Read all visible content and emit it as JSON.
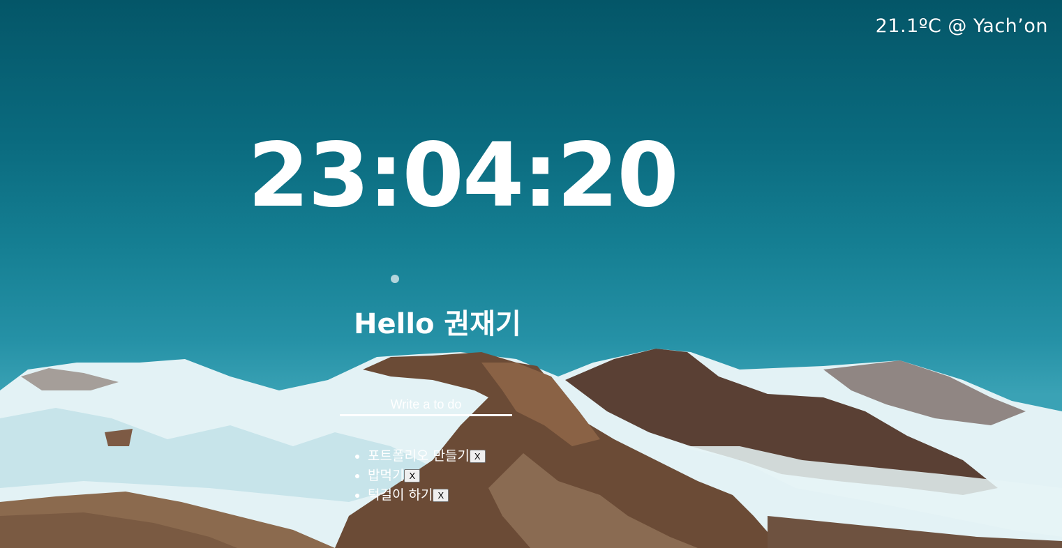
{
  "weather": {
    "text": "21.1ºC @ Yach’on"
  },
  "clock": {
    "time": "23:04:20"
  },
  "greeting": {
    "text": "Hello 권재기"
  },
  "todo_form": {
    "placeholder": "Write a to do"
  },
  "todos": [
    {
      "text": "포트폴리오 만들기",
      "delete_label": "X"
    },
    {
      "text": "밥먹기",
      "delete_label": "X"
    },
    {
      "text": "턱걸이 하기",
      "delete_label": "X"
    }
  ],
  "background": {
    "sky_top": "#045668",
    "sky_bottom": "#3aa2b5",
    "snow": "#e6f4f6",
    "rock": "#6a4a35"
  }
}
